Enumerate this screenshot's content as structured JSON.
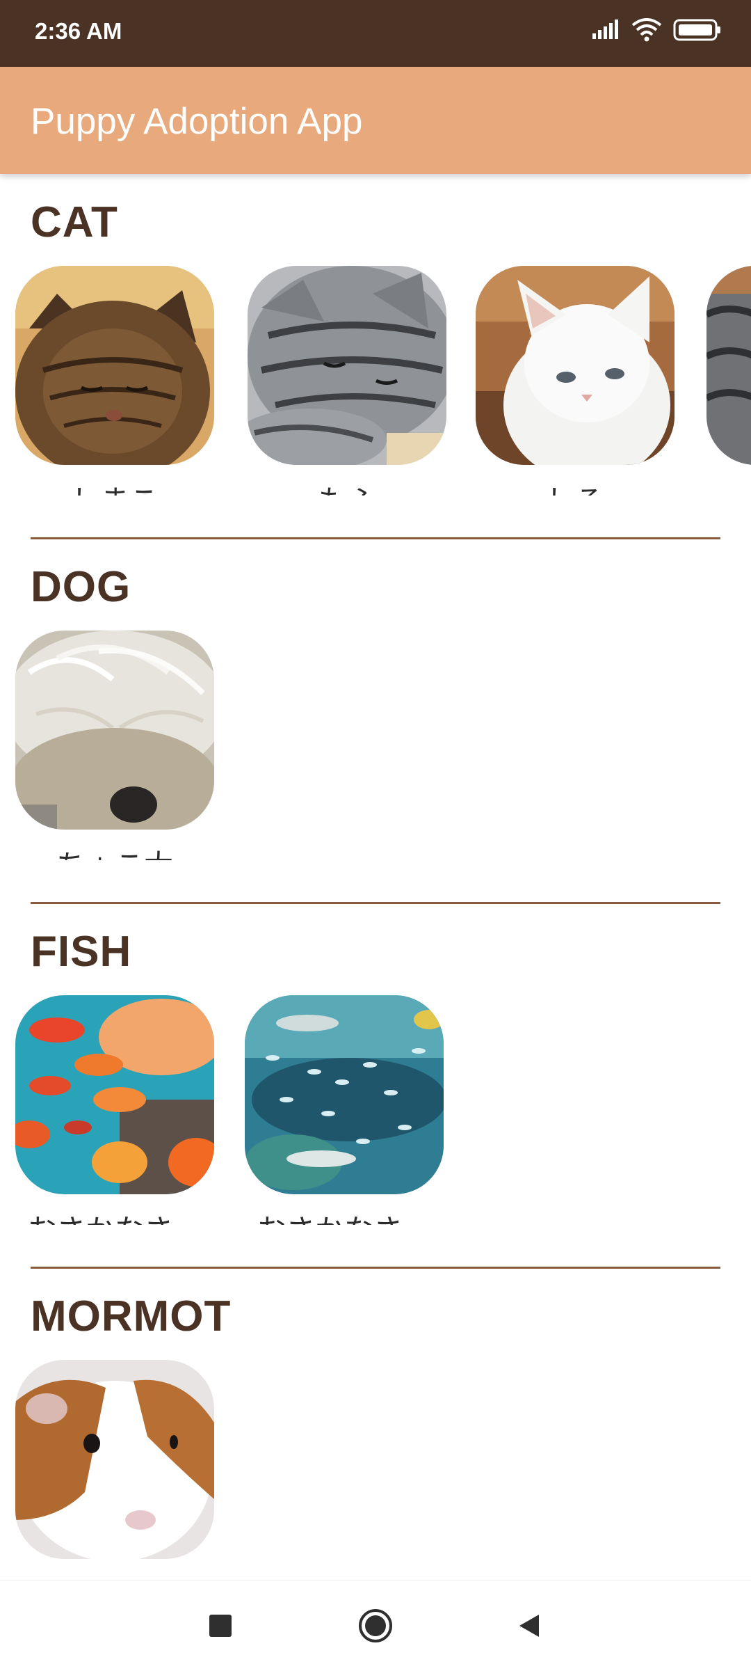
{
  "status_bar": {
    "time": "2:36 AM",
    "icons": [
      "signal-icon",
      "wifi-icon",
      "battery-icon"
    ]
  },
  "app_bar": {
    "title": "Puppy Adoption App"
  },
  "sections": [
    {
      "title": "CAT",
      "pets": [
        {
          "name": "しまこ",
          "photo": "tabby-cat-photo"
        },
        {
          "name": "もふ",
          "photo": "gray-tabby-cat-photo"
        },
        {
          "name": "しろ",
          "photo": "white-cat-photo"
        },
        {
          "name": "",
          "photo": "cat-photo-partial"
        }
      ]
    },
    {
      "title": "DOG",
      "pets": [
        {
          "name": "ちょこ太",
          "photo": "fluffy-dog-photo"
        }
      ]
    },
    {
      "title": "FISH",
      "pets": [
        {
          "name": "おさかなさ…",
          "photo": "goldfish-photo"
        },
        {
          "name": "おさかなさ…",
          "photo": "aquarium-school-photo"
        }
      ]
    },
    {
      "title": "MORMOT",
      "pets": [
        {
          "name": "",
          "photo": "guinea-pig-photo"
        }
      ]
    }
  ],
  "colors": {
    "status_bar": "#4a3224",
    "app_bar": "#e8a97c",
    "section_title": "#4a3224",
    "divider": "#8a5a3c"
  },
  "nav_bar": {
    "icons": [
      "recents-square-icon",
      "home-circle-icon",
      "back-triangle-icon"
    ]
  }
}
